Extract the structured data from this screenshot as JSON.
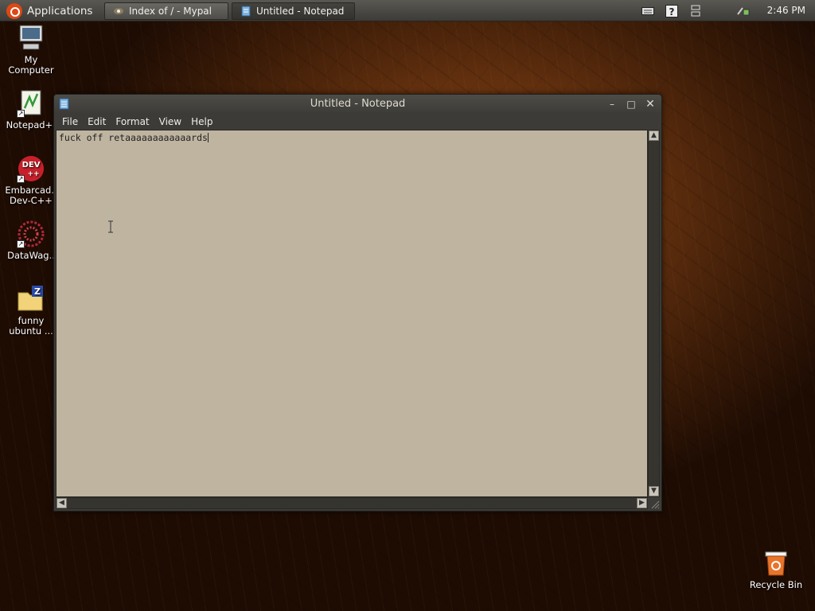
{
  "panel": {
    "apps_label": "Applications",
    "tasks": [
      {
        "label": "Index of / - Mypal"
      },
      {
        "label": "Untitled - Notepad"
      }
    ],
    "clock": "2:46 PM"
  },
  "desktop": {
    "icons": [
      {
        "label": "My Computer"
      },
      {
        "label": "Notepad+-"
      },
      {
        "label": "Embarcad.. Dev-C++"
      },
      {
        "label": "DataWag.."
      },
      {
        "label": "funny ubuntu ..."
      },
      {
        "label": "Recycle Bin"
      }
    ]
  },
  "window": {
    "title": "Untitled - Notepad",
    "menu": [
      "File",
      "Edit",
      "Format",
      "View",
      "Help"
    ],
    "content": "fuck off retaaaaaaaaaaaards"
  },
  "colors": {
    "accent": "#dd4814",
    "editor_bg": "#bfb4a0"
  },
  "icons": [
    "ubuntu-logo-icon",
    "notepad-icon",
    "keyboard-icon",
    "help-icon",
    "network-icon",
    "computer-icon",
    "recycle-bin-icon"
  ]
}
